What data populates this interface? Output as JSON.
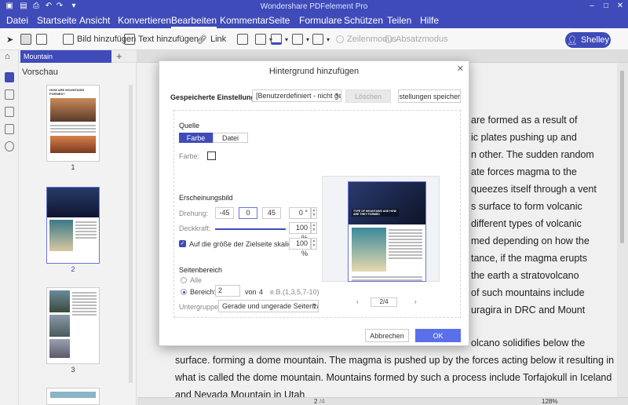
{
  "app": {
    "title": "Wondershare PDFelement Pro"
  },
  "menu": [
    "Datei",
    "Startseite",
    "Ansicht",
    "Konvertieren",
    "Bearbeiten",
    "Kommentar",
    "Seite",
    "Formulare",
    "Schützen",
    "Teilen",
    "Hilfe"
  ],
  "menu_active": "Bearbeiten",
  "toolbar": {
    "image_add": "Bild hinzufügen",
    "text_add": "Text hinzufügen",
    "link": "Link",
    "line_mode": "Zeilenmodus",
    "paragraph_mode": "Absatzmodus"
  },
  "user": {
    "name": "Shelley"
  },
  "tab": {
    "name": "Mountain",
    "add": "+"
  },
  "panel": {
    "title": "Vorschau",
    "pages": [
      "1",
      "2",
      "3"
    ],
    "thumb1_heading": "HOW ARE MOUNTAINS FORMED?"
  },
  "document": {
    "lines": [
      "are formed as a result of",
      "ic plates pushing up and",
      "n other. The sudden random",
      "ate forces magma to the",
      "queezes itself through a vent",
      "s surface to form volcanic",
      "different types of volcanic",
      "med depending on how the",
      "tance, if the magma erupts",
      "the earth a stratovolcano",
      "of such mountains include",
      "uragira in DRC and Mount"
    ],
    "full_lines": [
      "olcano solidifies below the",
      "surface. forming a dome mountain. The magma is pushed up by the forces acting below it resulting in",
      "what is called the dome mountain. Mountains formed by such a process include Torfajokull in Iceland",
      "and Nevada Mountain in Utah"
    ]
  },
  "status": {
    "page": "2",
    "total": "/4",
    "zoom": "128%"
  },
  "dialog": {
    "title": "Hintergrund hinzufügen",
    "saved_settings_label": "Gespeicherte Einstellungen:",
    "saved_settings_value": "[Benutzerdefiniert - nicht gesp",
    "delete_button": "Löschen",
    "save_settings_button": "Einstellungen speichern...",
    "source_heading": "Quelle",
    "source_color": "Farbe",
    "source_file": "Datei",
    "color_label": "Farbe:",
    "appearance_heading": "Erscheinungsbild",
    "rotation_label": "Drehung:",
    "rotation_options": [
      "-45",
      "0",
      "45"
    ],
    "rotation_value": "0 °",
    "opacity_label": "Deckkraft:",
    "opacity_value": "100 %",
    "scale_label": "Auf die größe der Zielseite skalieren:",
    "scale_value": "100 %",
    "page_range_heading": "Seitenbereich",
    "all_label": "Alle",
    "range_label": "Bereich:",
    "range_from": "2",
    "range_von": "von",
    "range_total": "4",
    "range_hint": "e.B.(1,3,5,7-10)",
    "subset_label": "Untergruppe:",
    "subset_value": "Gerade und ungerade Seitenzahl",
    "preview_page": "2/4",
    "preview_heading": "TYPE OF MOUNTAINS AND HOW ARE THEY FORMED",
    "cancel_button": "Abbrechen",
    "ok_button": "OK"
  }
}
